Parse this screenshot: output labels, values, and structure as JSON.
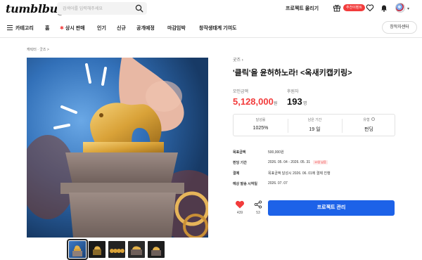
{
  "header": {
    "logo": "tumblbug",
    "search_placeholder": "검색어를 입력해주세요",
    "project_upload": "프로젝트 올리기",
    "event_badge": "추천이벤트",
    "icons": [
      "search-icon",
      "gift-icon",
      "heart-icon",
      "bell-icon",
      "avatar"
    ]
  },
  "nav": {
    "categories": "카테고리",
    "home": "홈",
    "always_on_sale": "상시 판매",
    "popular": "인기",
    "new": "신규",
    "upcoming": "공개예정",
    "closing": "마감임박",
    "creator_support": "창작생태계 기여도",
    "creator_center": "창작자센터"
  },
  "breadcrumb": "캐릭터 · 굿즈 >",
  "product": {
    "category": "굿즈",
    "title": "'클릭'을 윤허하노라! <옥새키캡키링>",
    "funding_label": "모인금액",
    "funding_amount": "5,128,000",
    "funding_unit": "원",
    "supporters_label": "후원자",
    "supporters_count": "193",
    "supporters_unit": "명",
    "stats": {
      "achievement_label": "달성률",
      "achievement_value": "1025%",
      "remaining_label": "남은 기간",
      "remaining_value": "19 일",
      "type_label": "유형",
      "type_value": "펀딩"
    },
    "info": {
      "goal_label": "목표금액",
      "goal_value": "500,000원",
      "period_label": "펀딩 기간",
      "period_value": "2026. 05. 04 - 2026. 05. 31",
      "period_badge": "19일 남음",
      "payment_label": "결제",
      "payment_value": "목표금액 달성시 2026. 06. 01에 결제 진행",
      "delivery_label": "예상 발송 시작일",
      "delivery_value": "2026. 07. 07"
    },
    "like_count": "439",
    "share_count": "53",
    "manage_button": "프로젝트 관리"
  },
  "colors": {
    "accent_red": "#f23b3b",
    "primary_blue": "#1d62e8"
  }
}
